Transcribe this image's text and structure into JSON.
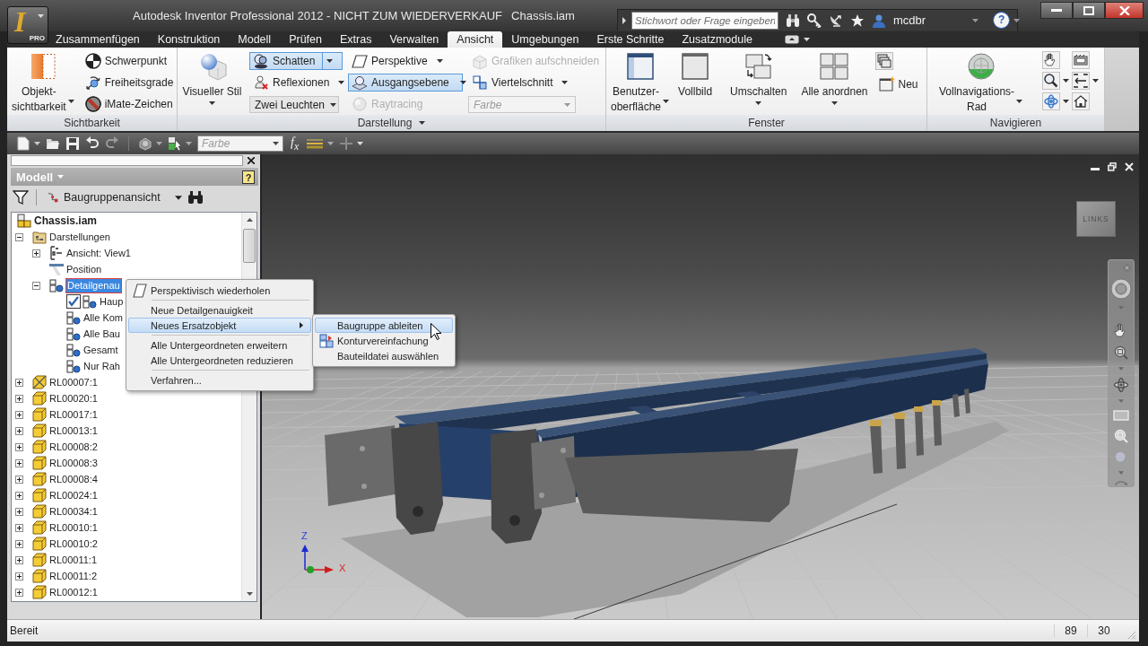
{
  "app_button": {
    "letter": "I",
    "badge": "PRO"
  },
  "window": {
    "title": "Autodesk Inventor Professional 2012 - NICHT ZUM WIEDERVERKAUF",
    "document": "Chassis.iam"
  },
  "infocenter": {
    "search_placeholder": "Stichwort oder Frage eingeben",
    "user": "mcdbr",
    "help": "?"
  },
  "tabs": [
    {
      "label": "Zusammenfügen",
      "selected": false
    },
    {
      "label": "Konstruktion",
      "selected": false
    },
    {
      "label": "Modell",
      "selected": false
    },
    {
      "label": "Prüfen",
      "selected": false
    },
    {
      "label": "Extras",
      "selected": false
    },
    {
      "label": "Verwalten",
      "selected": false
    },
    {
      "label": "Ansicht",
      "selected": true
    },
    {
      "label": "Umgebungen",
      "selected": false
    },
    {
      "label": "Erste Schritte",
      "selected": false
    },
    {
      "label": "Zusatzmodule",
      "selected": false
    }
  ],
  "ribbon": {
    "visibility": {
      "title": "Sichtbarkeit",
      "object_visibility": "Objekt-sichtbarkeit",
      "center_of_gravity": "Schwerpunkt",
      "degrees_of_freedom": "Freiheitsgrade",
      "imate": "iMate-Zeichen"
    },
    "appearance": {
      "title": "Darstellung",
      "visual_style": "Visueller Stil",
      "shadows": {
        "label": "Schatten",
        "on": true
      },
      "reflections": {
        "label": "Reflexionen",
        "on": false
      },
      "lighting": {
        "value": "Zwei Leuchten"
      },
      "perspective": "Perspektive",
      "ground_plane": {
        "label": "Ausgangsebene",
        "on": true
      },
      "ray_tracing": {
        "label": "Raytracing",
        "disabled": true
      },
      "slice_graphics": {
        "label": "Grafiken aufschneiden",
        "disabled": true
      },
      "quarter_section": "Viertelschnitt",
      "color": {
        "value": "Farbe",
        "disabled": true
      }
    },
    "windows": {
      "title": "Fenster",
      "user_interface": "Benutzer-oberfläche",
      "full_screen": "Vollbild",
      "switch": "Umschalten",
      "arrange_all": "Alle anordnen",
      "new": "Neu"
    },
    "navigate": {
      "title": "Navigieren",
      "full_navigation_wheel": "Vollnavigations-Rad"
    }
  },
  "quick_access": {
    "color": {
      "value": "Farbe",
      "disabled": true
    },
    "function": "f$_{x}$"
  },
  "browser": {
    "title": "Modell",
    "help": "?",
    "view": "Baugruppenansicht",
    "tree": [
      {
        "label": "Chassis.iam",
        "kind": "assembly",
        "selected": false,
        "children": [
          {
            "label": "Darstellungen",
            "kind": "folder",
            "expanded": true,
            "selected": false,
            "children": [
              {
                "label": "Ansicht: View1",
                "kind": "view",
                "expanded": false,
                "selected": false
              },
              {
                "label": "Position",
                "kind": "position",
                "selected": false
              },
              {
                "label": "Detailgenau",
                "kind": "lod",
                "expanded": true,
                "selected": true,
                "children": [
                  {
                    "label": "Haup",
                    "kind": "lod",
                    "checked": true,
                    "selected": false
                  },
                  {
                    "label": "Alle Kom",
                    "kind": "lod",
                    "checked": false,
                    "selected": false
                  },
                  {
                    "label": "Alle Bau",
                    "kind": "lod",
                    "checked": false,
                    "selected": false
                  },
                  {
                    "label": "Gesamt",
                    "kind": "lod",
                    "checked": false,
                    "selected": false
                  },
                  {
                    "label": "Nur Rah",
                    "kind": "lod",
                    "checked": false,
                    "selected": false
                  }
                ]
              }
            ]
          },
          {
            "label": "RL00007:1",
            "kind": "special",
            "expanded": false,
            "selected": false
          },
          {
            "label": "RL00020:1",
            "kind": "part",
            "expanded": false,
            "selected": false
          },
          {
            "label": "RL00017:1",
            "kind": "part",
            "expanded": false,
            "selected": false
          },
          {
            "label": "RL00013:1",
            "kind": "part",
            "expanded": false,
            "selected": false
          },
          {
            "label": "RL00008:2",
            "kind": "part",
            "expanded": false,
            "selected": false
          },
          {
            "label": "RL00008:3",
            "kind": "part",
            "expanded": false,
            "selected": false
          },
          {
            "label": "RL00008:4",
            "kind": "part",
            "expanded": false,
            "selected": false
          },
          {
            "label": "RL00024:1",
            "kind": "part",
            "expanded": false,
            "selected": false
          },
          {
            "label": "RL00034:1",
            "kind": "part",
            "expanded": false,
            "selected": false
          },
          {
            "label": "RL00010:1",
            "kind": "part",
            "expanded": false,
            "selected": false
          },
          {
            "label": "RL00010:2",
            "kind": "part",
            "expanded": false,
            "selected": false
          },
          {
            "label": "RL00011:1",
            "kind": "part",
            "expanded": false,
            "selected": false
          },
          {
            "label": "RL00011:2",
            "kind": "part",
            "expanded": false,
            "selected": false
          },
          {
            "label": "RL00012:1",
            "kind": "part",
            "expanded": false,
            "selected": false
          }
        ]
      }
    ]
  },
  "context_menu": {
    "items": [
      {
        "label": "Perspektivisch wiederholen",
        "separator_before": false,
        "submenu": false,
        "selected": false
      },
      {
        "label": "Neue Detailgenauigkeit",
        "separator_before": true,
        "submenu": false,
        "selected": false
      },
      {
        "label": "Neues Ersatzobjekt",
        "separator_before": false,
        "submenu": true,
        "selected": true
      },
      {
        "label": "Alle Untergeordneten erweitern",
        "separator_before": true,
        "submenu": false,
        "selected": false
      },
      {
        "label": "Alle Untergeordneten reduzieren",
        "separator_before": false,
        "submenu": false,
        "selected": false
      },
      {
        "label": "Verfahren...",
        "separator_before": true,
        "submenu": false,
        "selected": false
      }
    ],
    "submenu": [
      {
        "label": "Baugruppe ableiten",
        "selected": true
      },
      {
        "label": "Konturvereinfachung",
        "selected": false
      },
      {
        "label": "Bauteildatei auswählen",
        "selected": false
      }
    ]
  },
  "viewport": {
    "view_cube": "LINKS",
    "axes": {
      "z": "Z",
      "x": "X"
    }
  },
  "status_bar": {
    "text": "Bereit",
    "fields": [
      "89",
      "30"
    ]
  }
}
